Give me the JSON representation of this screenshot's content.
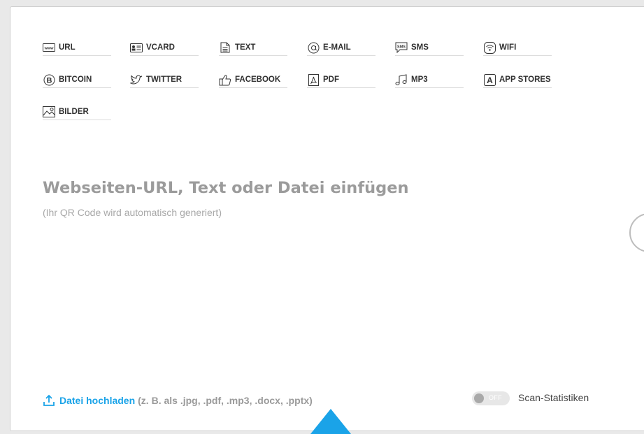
{
  "tabs": [
    {
      "id": "url",
      "label": "URL",
      "icon": "www-icon"
    },
    {
      "id": "vcard",
      "label": "VCARD",
      "icon": "contact-card-icon"
    },
    {
      "id": "text",
      "label": "TEXT",
      "icon": "document-icon"
    },
    {
      "id": "email",
      "label": "E-MAIL",
      "icon": "at-sign-icon"
    },
    {
      "id": "sms",
      "label": "SMS",
      "icon": "sms-bubble-icon"
    },
    {
      "id": "wifi",
      "label": "WIFI",
      "icon": "wifi-icon"
    },
    {
      "id": "bitcoin",
      "label": "BITCOIN",
      "icon": "bitcoin-icon"
    },
    {
      "id": "twitter",
      "label": "TWITTER",
      "icon": "twitter-bird-icon"
    },
    {
      "id": "facebook",
      "label": "FACEBOOK",
      "icon": "thumbs-up-icon"
    },
    {
      "id": "pdf",
      "label": "PDF",
      "icon": "pdf-icon"
    },
    {
      "id": "mp3",
      "label": "MP3",
      "icon": "music-note-icon"
    },
    {
      "id": "appstores",
      "label": "APP STORES",
      "icon": "app-store-icon"
    },
    {
      "id": "bilder",
      "label": "BILDER",
      "icon": "image-icon"
    }
  ],
  "main": {
    "title": "Webseiten-URL, Text oder Datei einfügen",
    "subtitle": "(Ihr QR Code wird automatisch generiert)"
  },
  "upload": {
    "link_label": "Datei hochladen",
    "hint": "(z. B. als .jpg, .pdf, .mp3, .docx, .pptx)",
    "icon": "upload-icon"
  },
  "scan_stats": {
    "toggle_state": "OFF",
    "label": "Scan-Statistiken"
  },
  "colors": {
    "accent": "#1aa3e8",
    "title_gray": "#9b9b9b",
    "border": "#cfcfcf"
  }
}
